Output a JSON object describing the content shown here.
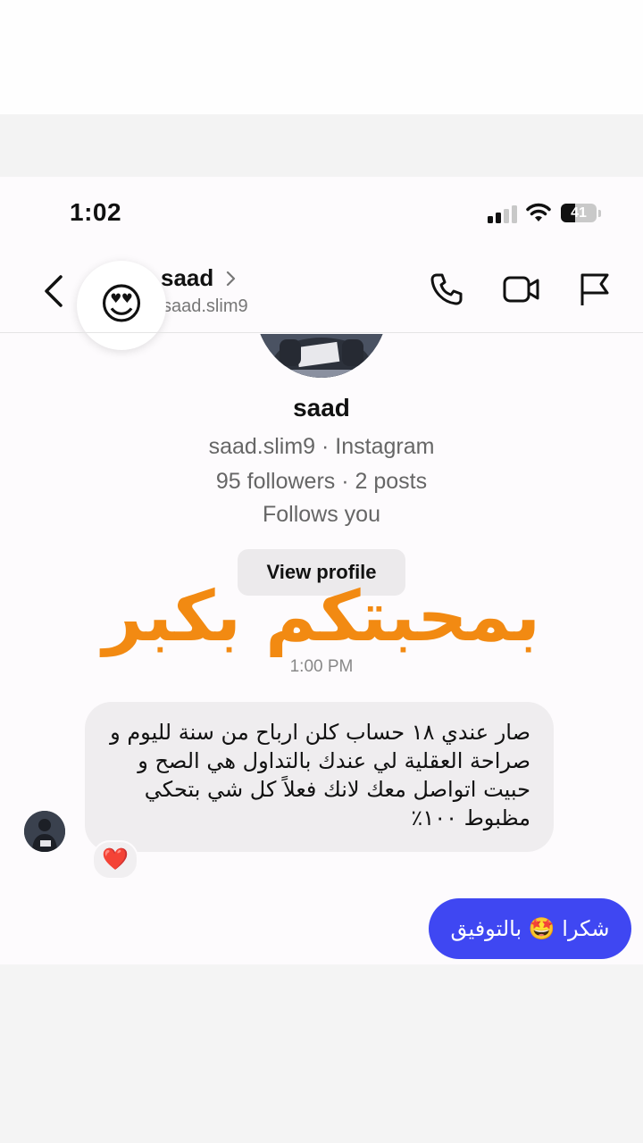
{
  "status_bar": {
    "time": "1:02",
    "battery_level": "41",
    "signal_bars_filled": 2,
    "signal_bars_total": 4
  },
  "header": {
    "name": "saad",
    "username": "saad.slim9",
    "reaction_emoji": "😍",
    "icons": [
      "back-icon",
      "phone-icon",
      "video-icon",
      "flag-icon"
    ]
  },
  "profile": {
    "name": "saad",
    "subtitle": "saad.slim9 · Instagram",
    "stats": "95 followers · 2 posts",
    "follow_status": "Follows you",
    "view_profile_label": "View profile"
  },
  "overlay_caption": "بمحبتكم بكبر",
  "timestamp": "1:00 PM",
  "messages": [
    {
      "direction": "incoming",
      "lines": [
        "صار عندي ١٨ حساب كلن ارباح من سنة لليوم و",
        "صراحة العقلية لي عندك بالتداول هي الصح و",
        "حبيت اتواصل معك لانك فعلاً كل شي بتحكي",
        "مظبوط ١٠٠٪"
      ],
      "reaction": "❤️"
    },
    {
      "direction": "outgoing",
      "text": "شكرا 🤩 بالتوفيق"
    }
  ],
  "colors": {
    "outgoing_bubble": "#3f47f2",
    "incoming_bubble": "#efedef",
    "overlay_text": "#f28a12"
  }
}
